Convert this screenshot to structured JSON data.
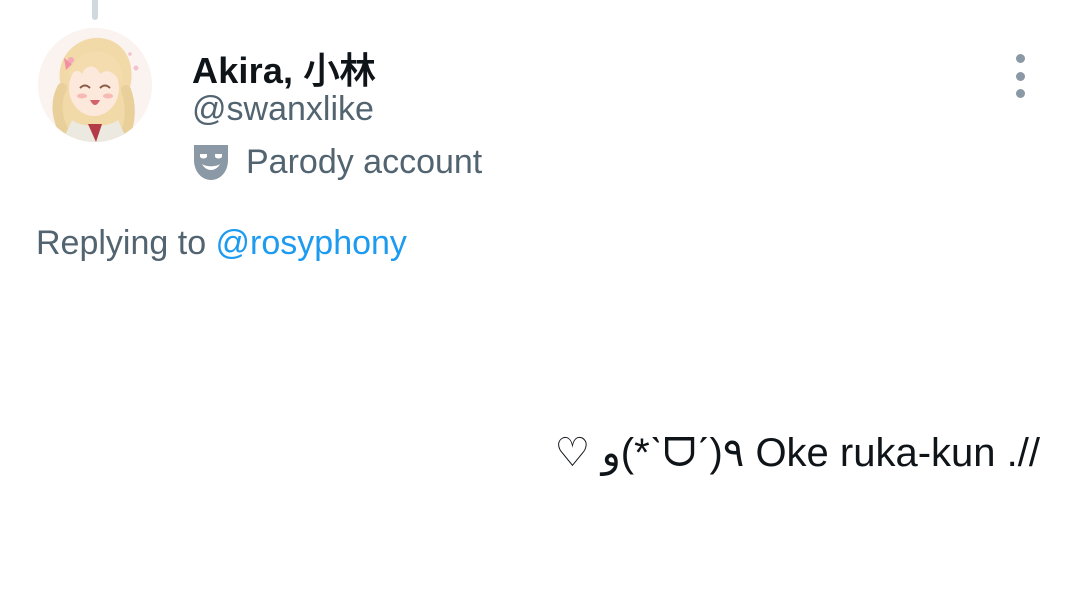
{
  "user": {
    "display_name": "Akira, 小林",
    "handle": "@swanxlike",
    "parody_label": "Parody account",
    "avatar_icon": "anime-avatar",
    "parody_icon": "theater-mask-icon"
  },
  "reply": {
    "prefix": "Replying to ",
    "mention": "@rosyphony"
  },
  "tweet": {
    "text": "♡ و(*ˋᗜˊ)٩ Oke ruka-kun .//"
  },
  "actions": {
    "more_icon": "more-vertical-icon"
  },
  "colors": {
    "text_primary": "#0f1419",
    "text_secondary": "#536471",
    "link": "#1d9bf0",
    "thread_line": "#cfd9de"
  }
}
